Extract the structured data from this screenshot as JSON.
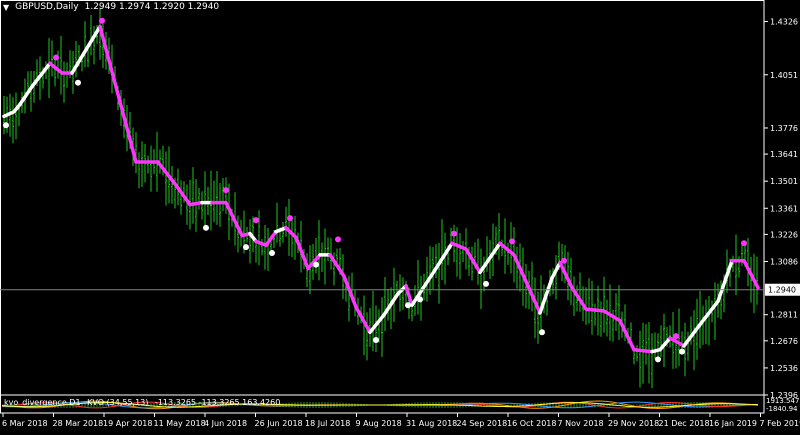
{
  "header": {
    "symbol_label": "GBPUSD,Daily",
    "ohlc": "1.2949 1.2974 1.2920 1.2940"
  },
  "indicator": {
    "name": "kvo_divergence D1",
    "params": "KVO (34,55,13)",
    "values": "-113.3265 -113.3265 163.4260",
    "scale_top": "1913.547",
    "scale_bottom": "-1840.94"
  },
  "price_axis": {
    "ticks": [
      "1.4326",
      "1.4051",
      "1.3776",
      "1.3641",
      "1.3501",
      "1.3361",
      "1.3226",
      "1.3086",
      "1.2811",
      "1.2676",
      "1.2536",
      "1.2396"
    ],
    "current": "1.2940"
  },
  "time_axis": {
    "labels": [
      "6 Mar 2018",
      "28 Mar 2018",
      "19 Apr 2018",
      "11 May 2018",
      "4 Jun 2018",
      "26 Jun 2018",
      "18 Jul 2018",
      "9 Aug 2018",
      "31 Aug 2018",
      "24 Sep 2018",
      "16 Oct 2018",
      "7 Nov 2018",
      "29 Nov 2018",
      "21 Dec 2018",
      "16 Jan 2019",
      "7 Feb 2019"
    ]
  },
  "colors": {
    "background": "#000000",
    "bars": "#1fc21f",
    "trend_up": "#ffffff",
    "trend_down": "#ff33ff",
    "grid": "#808080"
  },
  "chart_data": {
    "type": "line",
    "title": "GBPUSD,Daily",
    "x": [
      "6 Mar 2018",
      "28 Mar 2018",
      "19 Apr 2018",
      "11 May 2018",
      "4 Jun 2018",
      "26 Jun 2018",
      "18 Jul 2018",
      "9 Aug 2018",
      "31 Aug 2018",
      "24 Sep 2018",
      "16 Oct 2018",
      "7 Nov 2018",
      "29 Nov 2018",
      "21 Dec 2018",
      "16 Jan 2019",
      "7 Feb 2019"
    ],
    "series": [
      {
        "values": [
          1.382,
          1.405,
          1.426,
          1.353,
          1.336,
          1.317,
          1.311,
          1.276,
          1.3,
          1.31,
          1.292,
          1.285,
          1.264,
          1.267,
          1.29,
          1.294
        ]
      }
    ],
    "ylim": [
      1.2396,
      1.4396
    ]
  }
}
